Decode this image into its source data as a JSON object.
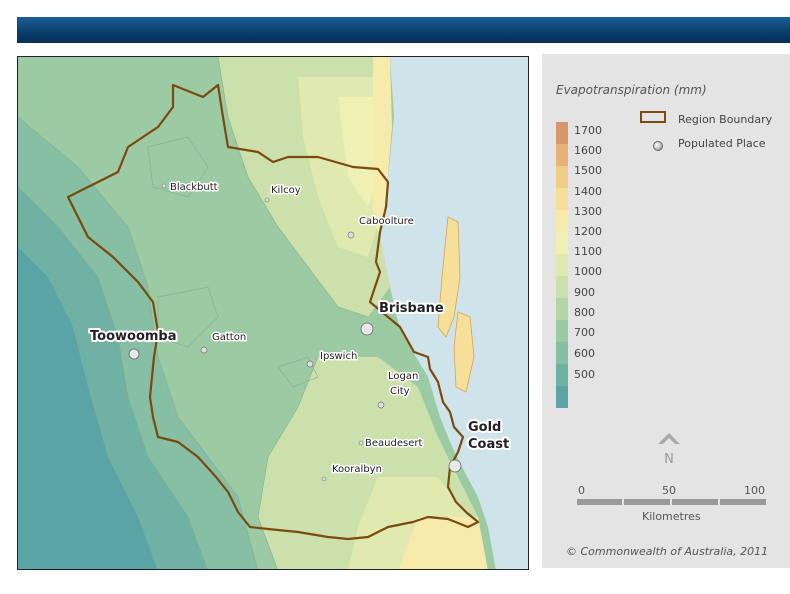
{
  "map": {
    "places": [
      {
        "name": "Blackbutt",
        "size": "small"
      },
      {
        "name": "Kilcoy",
        "size": "small"
      },
      {
        "name": "Caboolture",
        "size": "small"
      },
      {
        "name": "Brisbane",
        "size": "large"
      },
      {
        "name": "Toowoomba",
        "size": "large"
      },
      {
        "name": "Gatton",
        "size": "small"
      },
      {
        "name": "Ipswich",
        "size": "small"
      },
      {
        "name": "Logan",
        "size": "small"
      },
      {
        "name": "City",
        "size": "small"
      },
      {
        "name": "Gold",
        "size": "large"
      },
      {
        "name": "Coast",
        "size": "large"
      },
      {
        "name": "Beaudesert",
        "size": "small"
      },
      {
        "name": "Kooralbyn",
        "size": "small"
      }
    ]
  },
  "legend": {
    "title": "Evapotranspiration (mm)",
    "classes": [
      {
        "label": "1700",
        "color": "#d9956b"
      },
      {
        "label": "1600",
        "color": "#e6b277"
      },
      {
        "label": "1500",
        "color": "#f0cd86"
      },
      {
        "label": "1400",
        "color": "#f6df98"
      },
      {
        "label": "1300",
        "color": "#f7ebac"
      },
      {
        "label": "1200",
        "color": "#eef0b4"
      },
      {
        "label": "1100",
        "color": "#dfe9b0"
      },
      {
        "label": "1000",
        "color": "#cbe0ab"
      },
      {
        "label": "900",
        "color": "#b4d6a7"
      },
      {
        "label": "800",
        "color": "#9ccaa3"
      },
      {
        "label": "700",
        "color": "#86bfa3"
      },
      {
        "label": "600",
        "color": "#6fb2a3"
      },
      {
        "label": "500",
        "color": "#5aa4a6"
      }
    ],
    "region_boundary_label": "Region Boundary",
    "populated_place_label": "Populated Place",
    "north_label": "N",
    "scale_labels": [
      "0",
      "50",
      "100"
    ],
    "scale_unit": "Kilometres",
    "copyright": "© Commonwealth of Australia, 2011"
  },
  "colors": {
    "header": "#0b3f6e",
    "boundary": "#7a4a0e",
    "sea": "#cfe3ea"
  }
}
